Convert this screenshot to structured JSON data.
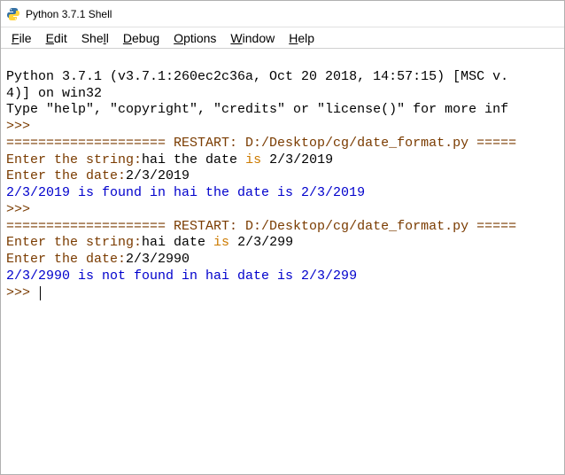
{
  "titlebar": {
    "title": "Python 3.7.1 Shell"
  },
  "menubar": {
    "file": "File",
    "edit": "Edit",
    "shell": "Shell",
    "debug": "Debug",
    "options": "Options",
    "window": "Window",
    "help": "Help"
  },
  "console": {
    "header1": "Python 3.7.1 (v3.7.1:260ec2c36a, Oct 20 2018, 14:57:15) [MSC v.",
    "header2": "4)] on win32",
    "header3": "Type \"help\", \"copyright\", \"credits\" or \"license()\" for more inf",
    "prompt": ">>>",
    "restart_line1": "==================== RESTART: D:/Desktop/cg/date_format.py =====",
    "run1": {
      "p1a": "Enter the string:",
      "p1b": "hai the date ",
      "p1c": "is",
      "p1d": " 2/3/2019",
      "p2a": "Enter the date:",
      "p2b": "2/3/2019",
      "result": "2/3/2019 is found in hai the date is 2/3/2019"
    },
    "restart_line2": "==================== RESTART: D:/Desktop/cg/date_format.py =====",
    "run2": {
      "p1a": "Enter the string:",
      "p1b": "hai date ",
      "p1c": "is",
      "p1d": " 2/3/299",
      "p2a": "Enter the date:",
      "p2b": "2/3/2990",
      "result": "2/3/2990 is not found in hai date is 2/3/299"
    }
  }
}
